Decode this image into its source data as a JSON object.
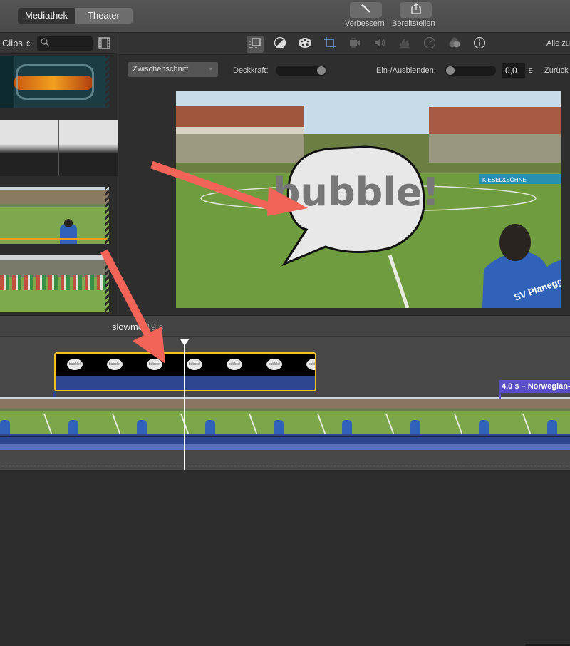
{
  "toolbar": {
    "tabs": [
      {
        "label": "Mediathek",
        "active": true
      },
      {
        "label": "Theater",
        "active": false
      }
    ],
    "enhance_label": "Verbessern",
    "share_label": "Bereitstellen"
  },
  "sidebar": {
    "clips_label": "Clips",
    "search_placeholder": "",
    "thumbnails": [
      {
        "name": "sci-fi-clip"
      },
      {
        "name": "white-gradient-clip"
      },
      {
        "name": "football-player-clip",
        "used_marker_color": "#f29a1a"
      },
      {
        "name": "football-teams-clip"
      }
    ]
  },
  "inspector": {
    "tools": [
      "video-overlay",
      "color-balance",
      "color-correction",
      "crop",
      "stabilization",
      "volume",
      "noise-reduction",
      "speed",
      "clip-filter",
      "clip-info"
    ],
    "active_tool": "crop",
    "reset_all_label": "Alle zu",
    "accent_color": "#6aa1e8"
  },
  "controls": {
    "overlay_mode": "Zwischenschnitt",
    "opacity_label": "Deckkraft:",
    "opacity_value": 1.0,
    "fade_label": "Ein-/Ausblenden:",
    "fade_value": "0,0",
    "fade_unit": "s",
    "reset_label": "Zurück"
  },
  "viewer": {
    "bubble_text": "bubble!",
    "jersey_text": "SV Planegg",
    "banner_text": "KIESEL&SÖHNE"
  },
  "timeline": {
    "project_title": "slowmo",
    "project_duration": "19 s",
    "title_clip_bubble_text": "bubble!",
    "title_clip_bubble_count": 7,
    "transition_label": "4,0 s – Norwegian-",
    "title_clip_border_color": "#f3c21b",
    "transition_color": "#5b4ec9"
  },
  "annotations": {
    "arrow_color": "#f26457"
  }
}
